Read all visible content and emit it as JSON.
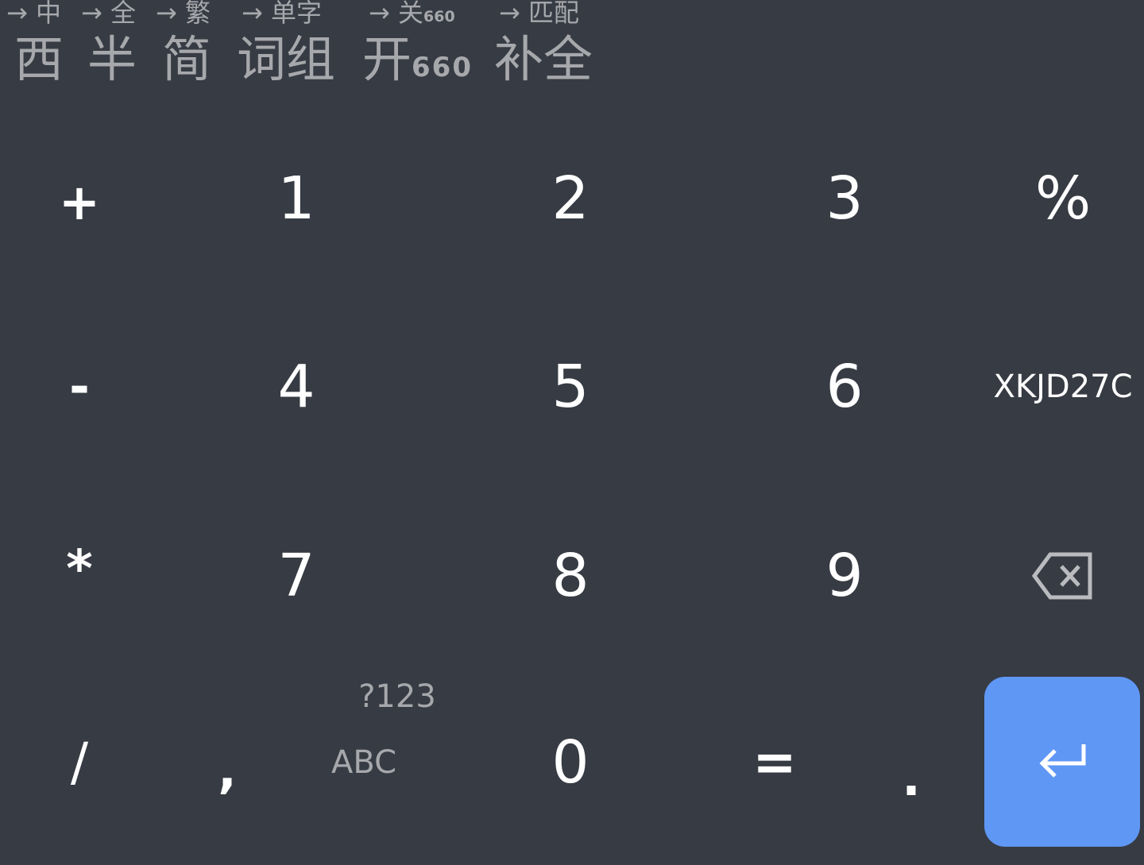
{
  "toolbar": {
    "items": [
      {
        "hint": "→ 中",
        "label": "西"
      },
      {
        "hint": "→ 全",
        "label": "半"
      },
      {
        "hint": "→ 繁",
        "label": "简"
      },
      {
        "hint": "→ 单字",
        "label": "词组"
      },
      {
        "hint": "→ 关",
        "hint_sub": "660",
        "label": "开",
        "label_sub": "660"
      },
      {
        "hint": "→ 匹配",
        "label": "补全"
      }
    ]
  },
  "keypad": {
    "row1": [
      "+",
      "1",
      "2",
      "3",
      "%"
    ],
    "row2": [
      "-",
      "4",
      "5",
      "6",
      "XKJD27C"
    ],
    "row3": [
      "*",
      "7",
      "8",
      "9"
    ],
    "row4": {
      "slash": "/",
      "comma": ",",
      "switch_top": "?123",
      "switch_bottom": "ABC",
      "zero": "0",
      "equals": "=",
      "dot": "."
    },
    "backspace_icon": "backspace-icon",
    "enter_icon": "enter-icon"
  },
  "colors": {
    "background": "#373b43",
    "enter_key": "#5f97f5",
    "secondary_text": "#a6a8ac"
  }
}
